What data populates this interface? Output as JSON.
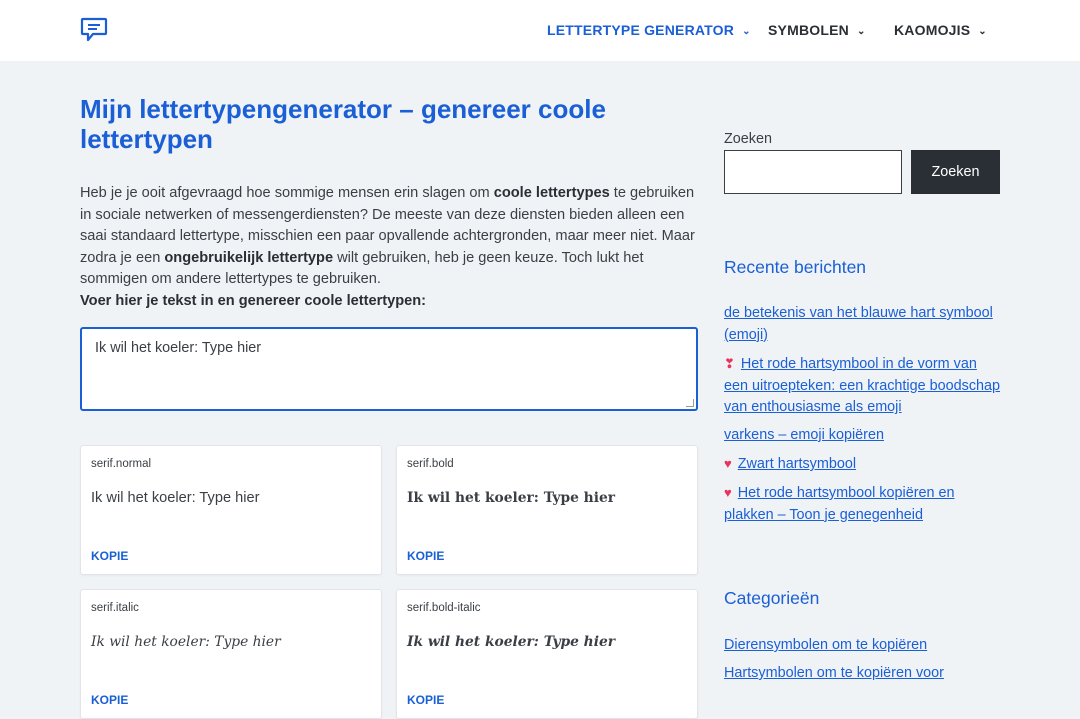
{
  "header": {
    "logo_icon": "chat-bubble-icon",
    "nav": [
      {
        "label": "LETTERTYPE GENERATOR",
        "active": true
      },
      {
        "label": "SYMBOLEN",
        "active": false
      },
      {
        "label": "KAOMOJIS",
        "active": false
      }
    ],
    "chevron": "⌄"
  },
  "main": {
    "title": "Mijn lettertypengenerator – genereer coole lettertypen",
    "intro_parts": {
      "p1": "Heb je je ooit afgevraagd hoe sommige mensen erin slagen om ",
      "b1": "coole lettertypes",
      "p2": " te gebruiken in sociale netwerken of messengerdiensten? De meeste van deze diensten bieden alleen een saai standaard lettertype, misschien een paar opvallende achtergronden, maar meer niet. Maar zodra je een ",
      "b2": "ongebruikelijk lettertype",
      "p3": " wilt gebruiken, heb je geen keuze. Toch lukt het sommigen om andere lettertypes te gebruiken."
    },
    "prompt": "Voer hier je tekst in en genereer coole lettertypen:",
    "input_value": "Ik wil het koeler: Type hier",
    "cards": [
      {
        "label": "serif.normal",
        "text": "Ik wil het koeler: Type hier",
        "button": "KOPIE"
      },
      {
        "label": "serif.bold",
        "text": "Ik wil het koeler: Type hier",
        "button": "KOPIE"
      },
      {
        "label": "serif.italic",
        "text": "Ik wil het koeler: Type hier",
        "button": "KOPIE"
      },
      {
        "label": "serif.bold-italic",
        "text": "Ik wil het koeler: Type hier",
        "button": "KOPIE"
      }
    ]
  },
  "sidebar": {
    "search_label": "Zoeken",
    "search_button": "Zoeken",
    "recent_title": "Recente berichten",
    "recent": [
      {
        "text": "de betekenis van het blauwe hart symbool (emoji)"
      },
      {
        "heart": "❣",
        "text": "Het rode hartsymbool in de vorm van een uitroepteken: een krachtige boodschap van enthousiasme als emoji"
      },
      {
        "text": "varkens – emoji kopiëren"
      },
      {
        "heart": "♥",
        "text": "Zwart hartsymbool"
      },
      {
        "heart": "♥",
        "text": "Het rode hartsymbool kopiëren en plakken – Toon je genegenheid"
      }
    ],
    "categories_title": "Categorieën",
    "categories": [
      {
        "text": "Dierensymbolen om te kopiëren"
      },
      {
        "text": "Hartsymbolen om te kopiëren voor"
      }
    ]
  }
}
